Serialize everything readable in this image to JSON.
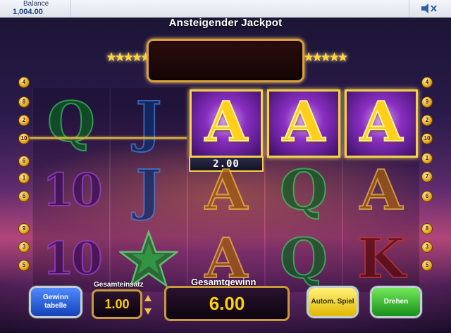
{
  "topbar": {
    "balance_label": "Balance",
    "balance_value": "1,004.00",
    "sound_icon": "speaker-mute-icon"
  },
  "jackpot": {
    "title": "Ansteigender Jackpot",
    "value": ""
  },
  "reels": [
    [
      "Q",
      "10",
      "10"
    ],
    [
      "J",
      "J",
      "star"
    ],
    [
      "A",
      "A",
      "A"
    ],
    [
      "A",
      "Q",
      "Q"
    ],
    [
      "A",
      "A",
      "K"
    ]
  ],
  "win": {
    "winning_line": 2,
    "symbol_value": "2.00"
  },
  "line_markers": {
    "left": [
      "4",
      "8",
      "2",
      "10",
      "6",
      "1",
      "6",
      "9",
      "3",
      "5"
    ],
    "right": [
      "4",
      "9",
      "2",
      "10",
      "7",
      "1",
      "6",
      "8",
      "3",
      "5"
    ]
  },
  "controls": {
    "paytable_label": "Gewinn tabelle",
    "stake_label": "Gesamteinsatz",
    "stake_value": "1.00",
    "total_win_label": "Gesamtgewinn",
    "total_win_value": "6.00",
    "autoplay_label": "Autom. Spiel",
    "spin_label": "Drehen"
  },
  "colors": {
    "accent_gold": "#f5cf47",
    "paytable_button": "#1441b8",
    "autoplay_button": "#e0b800",
    "spin_button": "#17901a"
  }
}
